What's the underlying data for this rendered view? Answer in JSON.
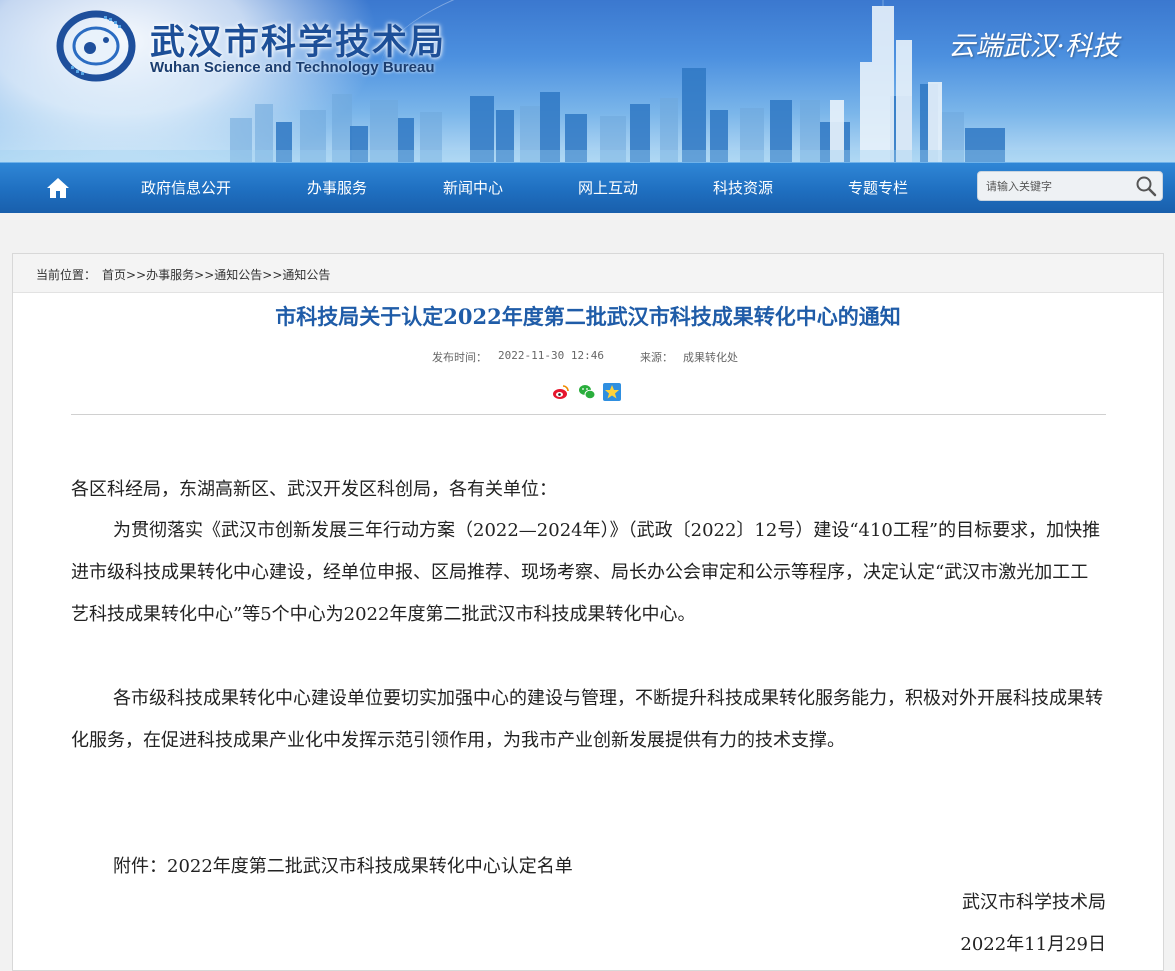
{
  "header": {
    "title_cn": "武汉市科学技术局",
    "title_en": "Wuhan Science and Technology Bureau",
    "slogan": "云端武汉·科技"
  },
  "nav": {
    "home_icon": "home-icon",
    "items": [
      "政府信息公开",
      "办事服务",
      "新闻中心",
      "网上互动",
      "科技资源",
      "专题专栏"
    ],
    "search_placeholder": "请输入关键字",
    "search_icon": "search-icon"
  },
  "breadcrumb": {
    "label": "当前位置：",
    "items": [
      "首页",
      "办事服务",
      "通知公告",
      "通知公告"
    ],
    "separator": ">>"
  },
  "article": {
    "title": "市科技局关于认定2022年度第二批武汉市科技成果转化中心的通知",
    "publish_label": "发布时间：",
    "publish_time": "2022-11-30 12:46",
    "source_label": "来源：",
    "source": "成果转化处",
    "share_icons": [
      "weibo-icon",
      "wechat-icon",
      "qzone-icon"
    ],
    "salutation": "各区科经局，东湖高新区、武汉开发区科创局，各有关单位：",
    "paragraphs": [
      "为贯彻落实《武汉市创新发展三年行动方案（2022—2024年）》（武政〔2022〕12号）建设“410工程”的目标要求，加快推进市级科技成果转化中心建设，经单位申报、区局推荐、现场考察、局长办公会审定和公示等程序，决定认定“武汉市激光加工工艺科技成果转化中心”等5个中心为2022年度第二批武汉市科技成果转化中心。",
      "各市级科技成果转化中心建设单位要切实加强中心的建设与管理，不断提升科技成果转化服务能力，积极对外开展科技成果转化服务，在促进科技成果产业化中发挥示范引领作用，为我市产业创新发展提供有力的技术支撑。"
    ],
    "attachment": "附件：2022年度第二批武汉市科技成果转化中心认定名单",
    "signature": "武汉市科学技术局",
    "date": "2022年11月29日"
  },
  "colors": {
    "nav_bg": "#1f6fc0",
    "title": "#1f5ca8",
    "text": "#222222"
  }
}
